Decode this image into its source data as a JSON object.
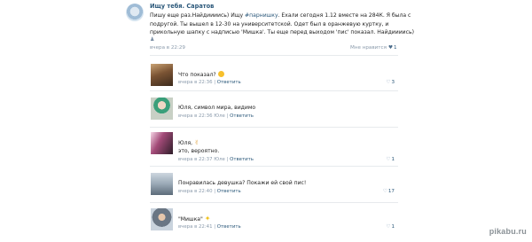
{
  "post": {
    "group_name": "Ищу тебя. Саратов",
    "text_parts": [
      "Пишу еще раз.Найдииииcь) Ищу ",
      "#парнишку",
      ". Ехали сегодня 1.12 вместе на 284К. Я была с подругой. Ты вышел в 12-30 на университетской. Одет был в оранжевую куртку, и прикольную шапку с надписью 'Мишка'. Ты еще перед выходом 'пис' показал. Найдииииcь)"
    ],
    "author_mark": "♟",
    "time": "вчера в 22:29",
    "likes_label": "Мне нравится",
    "likes_icon": "heart-icon",
    "likes_count": "1"
  },
  "comments": [
    {
      "text": "Что показал?",
      "emoji": "smiley-icon",
      "time": "вчера в 22:36",
      "reply": "Ответить",
      "likes": "3"
    },
    {
      "text": "Юля, символ мира, видимо",
      "time": "вчера в 22:36 Юле",
      "reply": "Ответить",
      "likes": ""
    },
    {
      "text": "Юля,",
      "emoji": "victory-hand-icon",
      "text2": "это, вероятно.",
      "time": "вчера в 22:37 Юле",
      "reply": "Ответить",
      "likes": "1"
    },
    {
      "text": "Понравилась девушка? Покажи ей свой пис!",
      "time": "вчера в 22:40",
      "reply": "Ответить",
      "likes": "17"
    },
    {
      "text": "\"Мишка\"",
      "emoji": "sparkles-icon",
      "time": "вчера в 22:41",
      "reply": "Ответить",
      "likes": "1"
    }
  ],
  "watermark": "pikabu.ru"
}
